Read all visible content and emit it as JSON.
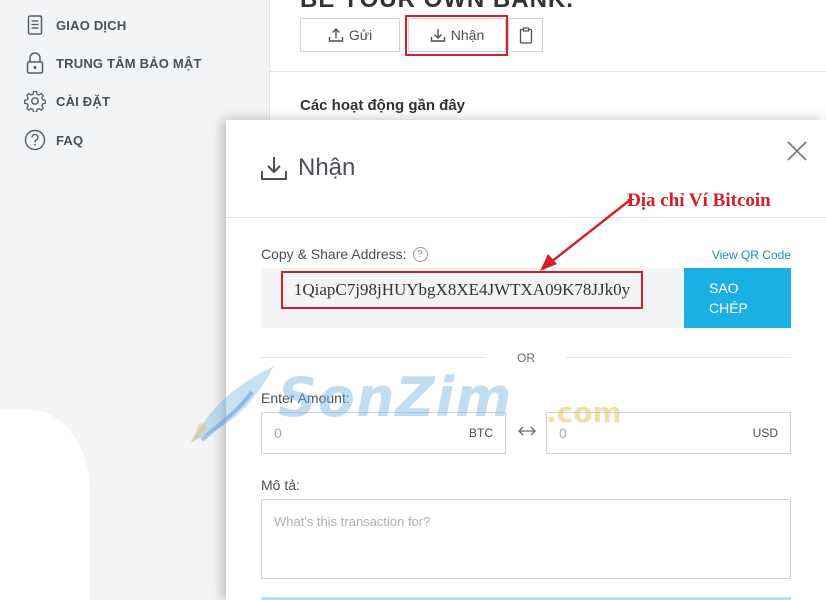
{
  "sidebar": {
    "items": [
      {
        "label": "GIAO DỊCH",
        "icon": "document-icon"
      },
      {
        "label": "TRUNG TÂM BẢO MẬT",
        "icon": "lock-icon"
      },
      {
        "label": "CÀI ĐẶT",
        "icon": "gear-icon"
      },
      {
        "label": "FAQ",
        "icon": "question-icon"
      }
    ]
  },
  "page": {
    "title_partial": "BE YOUR OWN BANK.",
    "send_label": "Gửi",
    "receive_label": "Nhận",
    "recent_title": "Các hoạt động gần đây"
  },
  "modal": {
    "title": "Nhận",
    "copy_share_label": "Copy & Share Address:",
    "help": "?",
    "view_qr": "View QR Code",
    "address": "1QiapC7j98jHUYbgX8XE4JWTXA09K78JJk0y",
    "copy_btn_line1": "SAO",
    "copy_btn_line2": "CHÉP",
    "or_text": "OR",
    "amount_label": "Enter Amount:",
    "btc_value": "0",
    "btc_unit": "BTC",
    "usd_value": "0",
    "usd_unit": "USD",
    "description_label": "Mô tả:",
    "description_placeholder": "What's this transaction for?"
  },
  "annotation": {
    "text": "Địa chỉ Ví Bitcoin"
  },
  "watermark": {
    "text": "SonZim",
    "suffix": ".com"
  },
  "colors": {
    "accent": "#1ab0e3",
    "highlight": "#d21f2a",
    "sidebar_bg": "#f3f4f5"
  }
}
